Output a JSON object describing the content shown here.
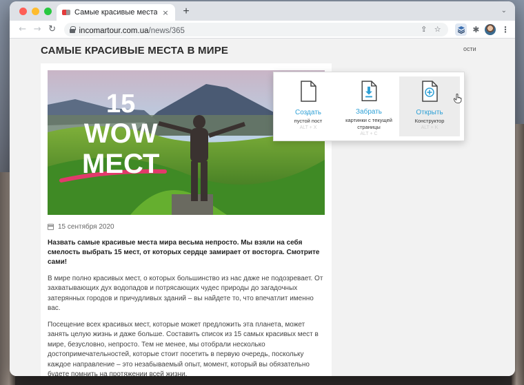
{
  "browser": {
    "tab_title": "Самые красивые места в мире",
    "tab_close": "×",
    "new_tab": "+",
    "tab_strip_chevron": "⌄",
    "url_host": "incomartour.com.ua",
    "url_path": "/news/365",
    "back": "←",
    "forward": "→",
    "reload": "↻",
    "share_icon": "⇪",
    "bookmark_icon": "☆",
    "puzzle_icon": "✱",
    "menu_icon": "⋮"
  },
  "page": {
    "title": "САМЫЕ КРАСИВЫЕ МЕСТА В МИРЕ",
    "sidebar_label": "ости"
  },
  "article": {
    "hero": {
      "number": "15",
      "line1": "WOW",
      "line2": "МЕСТ"
    },
    "date": "15 сентября 2020",
    "lead": "Назвать самые красивые места мира весьма непросто. Мы взяли на себя смелость выбрать 15 мест, от которых сердце замирает от восторга. Смотрите сами!",
    "paragraphs": [
      "В мире полно красивых мест, о которых большинство из нас даже не подозревает. От захватывающих дух водопадов и потрясающих чудес природы до загадочных затерянных городов и причудливых зданий – вы найдете то, что впечатлит именно вас.",
      "Посещение всех красивых мест, которые может предложить эта планета, может занять целую жизнь и даже больше. Составить список из 15 самых красивых мест в мире, безусловно, непросто. Тем не менее, мы отобрали несколько достопримечательностей, которые стоит посетить в первую очередь, поскольку каждое направление – это незабываемый опыт, момент, который вы обязательно будете помнить на протяжении всей жизни."
    ]
  },
  "popup": {
    "items": [
      {
        "title": "Создать",
        "subtitle": "пустой пост",
        "hint": "ALT + X"
      },
      {
        "title": "Забрать",
        "subtitle": "картинки с текущей страницы",
        "hint": "ALT + C"
      },
      {
        "title": "Открыть",
        "subtitle": "Конструктор",
        "hint": "ALT + K"
      }
    ],
    "accent_color": "#2ea0d6"
  }
}
